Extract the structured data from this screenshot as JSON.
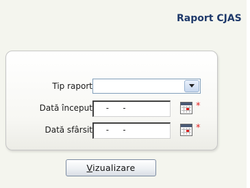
{
  "header": {
    "title": "Raport CJAS"
  },
  "form": {
    "report_type": {
      "label": "Tip raport",
      "value": ""
    },
    "start_date": {
      "label": "Dată început",
      "value": " -  - ",
      "required_mark": "*"
    },
    "end_date": {
      "label": "Dată sfârsit",
      "value": " -  - ",
      "required_mark": "*"
    }
  },
  "actions": {
    "view_button": {
      "accesskey": "V",
      "rest": "izualizare"
    }
  },
  "colors": {
    "title": "#1f3a6b",
    "required": "#e02020",
    "panel_border": "#c5c5c5"
  },
  "icons": {
    "dropdown": "chevron-down-icon",
    "calendar": "calendar-icon"
  }
}
